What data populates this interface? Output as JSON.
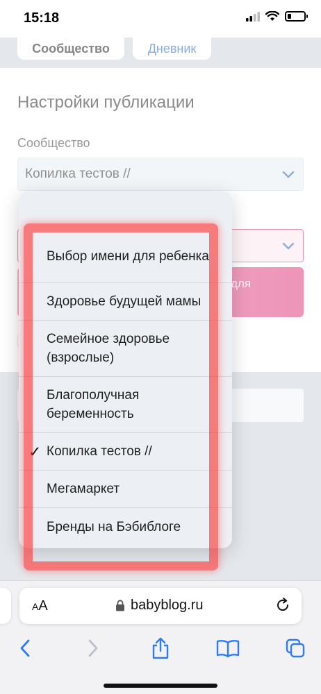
{
  "status_bar": {
    "time": "15:18"
  },
  "tabs": {
    "community": "Сообщество",
    "diary": "Дневник"
  },
  "settings": {
    "title": "Настройки публикации",
    "community_label": "Сообщество",
    "community_selected": "Копилка тестов //",
    "button_text_fragment": "для"
  },
  "picker": {
    "options": [
      {
        "label": "Выбор имени для ребенка",
        "selected": false
      },
      {
        "label": "Здоровье будущей мамы",
        "selected": false
      },
      {
        "label": "Семейное здоровье (взрослые)",
        "selected": false
      },
      {
        "label": "Благополучная беременность",
        "selected": false
      },
      {
        "label": "Копилка тестов //",
        "selected": true
      },
      {
        "label": "Мегамаркет",
        "selected": false
      },
      {
        "label": "Бренды на Бэбиблоге",
        "selected": false
      }
    ],
    "check_mark": "✓"
  },
  "browser": {
    "aa_small": "A",
    "aa_large": "A",
    "url": "babyblog.ru"
  },
  "colors": {
    "accent_blue": "#2e6ab3",
    "accent_pink": "#df3f7f",
    "highlight_red": "#ff2d2d",
    "page_gray": "#ced6de"
  },
  "icons": [
    "signal-icon",
    "wifi-icon",
    "battery-icon",
    "chevron-down-icon",
    "lock-icon",
    "reload-icon",
    "back-icon",
    "forward-icon",
    "share-icon",
    "bookmarks-icon",
    "tabs-icon"
  ]
}
